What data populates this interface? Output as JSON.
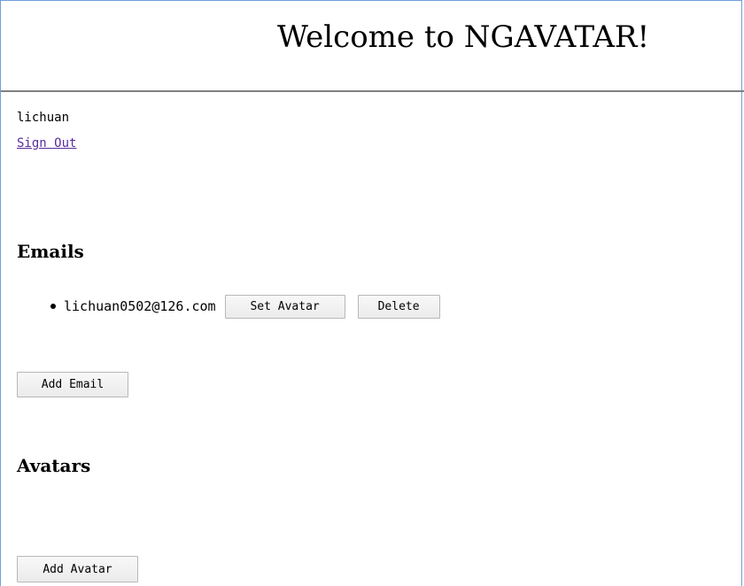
{
  "header": {
    "title": "Welcome to NGAVATAR!"
  },
  "user": {
    "name": "lichuan",
    "sign_out_label": "Sign Out"
  },
  "emails": {
    "title": "Emails",
    "items": [
      {
        "address": "lichuan0502@126.com",
        "set_avatar_label": "Set Avatar",
        "delete_label": "Delete"
      }
    ],
    "add_label": "Add Email"
  },
  "avatars": {
    "title": "Avatars",
    "add_label": "Add Avatar"
  },
  "colors": {
    "link": "#5a2ca0",
    "frame_border": "#6f9fd8",
    "rule": "#808080"
  }
}
